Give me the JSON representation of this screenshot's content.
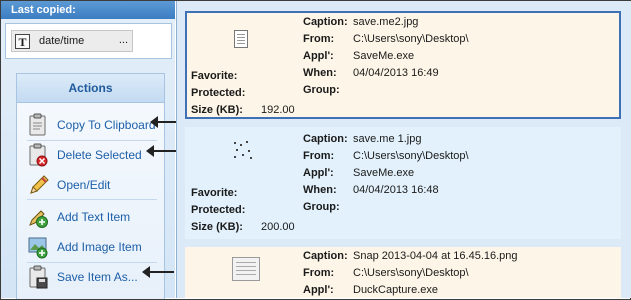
{
  "last_copied": {
    "title": "Last copied:",
    "item_icon_text": "T",
    "item_label": "date/time",
    "more_label": "..."
  },
  "actions": {
    "title": "Actions",
    "items": [
      {
        "label": "Copy To Clipboard",
        "icon": "clipboard-icon"
      },
      {
        "label": "Delete Selected",
        "icon": "delete-clipboard-icon"
      },
      {
        "label": "Open/Edit",
        "icon": "pencil-icon"
      },
      {
        "label": "Add Text Item",
        "icon": "add-text-icon"
      },
      {
        "label": "Add Image Item",
        "icon": "add-image-icon"
      },
      {
        "label": "Save Item As...",
        "icon": "save-item-icon"
      }
    ]
  },
  "labels": {
    "caption": "Caption:",
    "from": "From:",
    "appl": "Appl':",
    "when": "When:",
    "group": "Group:",
    "favorite": "Favorite:",
    "protected": "Protected:",
    "size": "Size (KB):"
  },
  "items": [
    {
      "caption": "save.me2.jpg",
      "from": "C:\\Users\\sony\\Desktop\\",
      "appl": "SaveMe.exe",
      "when": "04/04/2013 16:49",
      "group": "",
      "size": "192.00",
      "selected": true,
      "bg": "#fdf6e8"
    },
    {
      "caption": "save.me 1.jpg",
      "from": "C:\\Users\\sony\\Desktop\\",
      "appl": "SaveMe.exe",
      "when": "04/04/2013 16:48",
      "group": "",
      "size": "200.00",
      "selected": false,
      "bg": "#e2f1fb"
    },
    {
      "caption": "Snap 2013-04-04 at 16.45.16.png",
      "from": "C:\\Users\\sony\\Desktop\\",
      "appl": "DuckCapture.exe",
      "selected": false,
      "bg": "#fdf6e8"
    }
  ],
  "colors": {
    "accent": "#3b7dc2",
    "selection_border": "#3f6fb5",
    "link": "#1d5fa8"
  }
}
